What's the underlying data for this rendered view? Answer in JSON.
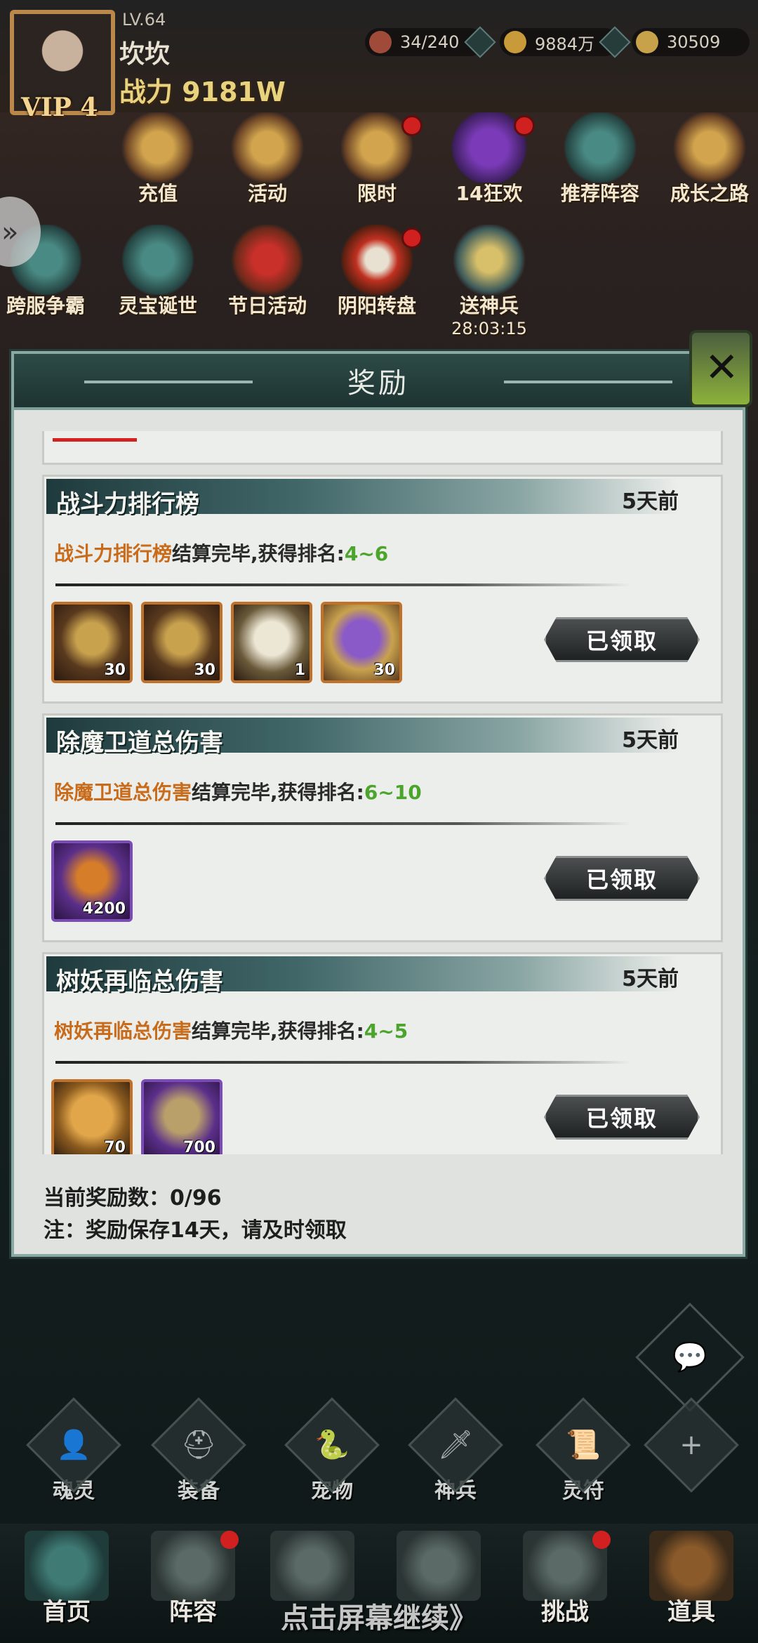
{
  "player": {
    "level": "LV.64",
    "name": "坎坎",
    "power": "战力 9181W",
    "vip": "VIP 4"
  },
  "resources": [
    {
      "icon": "stamina-icon",
      "value": "34/240"
    },
    {
      "icon": "coin-icon",
      "value": "9884万"
    },
    {
      "icon": "ingot-icon",
      "value": "30509"
    }
  ],
  "activities": [
    {
      "label": "充值",
      "icon": "recharge-icon",
      "dot": false
    },
    {
      "label": "活动",
      "icon": "activity-icon",
      "dot": false
    },
    {
      "label": "限时",
      "icon": "limited-icon",
      "dot": true
    },
    {
      "label": "14狂欢",
      "icon": "gift-box-icon",
      "dot": true
    },
    {
      "label": "推荐阵容",
      "icon": "lineup-icon",
      "dot": false
    },
    {
      "label": "成长之路",
      "icon": "growth-icon",
      "dot": false
    },
    {
      "label": "跨服争霸",
      "icon": "cross-server-icon",
      "dot": false
    },
    {
      "label": "灵宝诞世",
      "icon": "treasure-icon",
      "dot": false
    },
    {
      "label": "节日活动",
      "icon": "festival-icon",
      "dot": false
    },
    {
      "label": "阴阳转盘",
      "icon": "wheel-icon",
      "dot": true
    },
    {
      "label": "送神兵",
      "icon": "weapon-gift-icon",
      "dot": false,
      "timer": "28:03:15"
    }
  ],
  "modal": {
    "title": "奖励",
    "claim_label": "已领取",
    "cards": [
      {
        "title": "战斗力排行榜",
        "time": "5天前",
        "desc_name": "战斗力排行榜",
        "desc_mid": "结算完毕,获得排名:",
        "rank": "4~6",
        "items": [
          {
            "icon": "treasure-chest-icon",
            "count": "30",
            "style": "orange"
          },
          {
            "icon": "key-icon",
            "count": "30",
            "style": "orange"
          },
          {
            "icon": "scroll-icon",
            "count": "1",
            "style": "orange"
          },
          {
            "icon": "purple-chest-icon",
            "count": "30",
            "style": "orange"
          }
        ]
      },
      {
        "title": "除魔卫道总伤害",
        "time": "5天前",
        "desc_name": "除魔卫道总伤害",
        "desc_mid": "结算完毕,获得排名:",
        "rank": "6~10",
        "items": [
          {
            "icon": "flame-icon",
            "count": "4200",
            "style": "purple"
          }
        ]
      },
      {
        "title": "树妖再临总伤害",
        "time": "5天前",
        "desc_name": "树妖再临总伤害",
        "desc_mid": "结算完毕,获得排名:",
        "rank": "4~5",
        "items": [
          {
            "icon": "gold-orb-icon",
            "count": "70",
            "style": "orange"
          },
          {
            "icon": "bundle-icon",
            "count": "700",
            "style": "purple"
          }
        ]
      }
    ],
    "reward_count": "当前奖励数：0/96",
    "note": "注：奖励保存14天，请及时领取"
  },
  "tools": [
    {
      "label": "魂灵",
      "icon": "soul-icon",
      "glyph": "👤"
    },
    {
      "label": "装备",
      "icon": "equipment-icon",
      "glyph": "⛑"
    },
    {
      "label": "宠物",
      "icon": "pet-icon",
      "glyph": "🐍"
    },
    {
      "label": "神兵",
      "icon": "divine-weapon-icon",
      "glyph": "🗡"
    },
    {
      "label": "灵符",
      "icon": "talisman-icon",
      "glyph": "📜"
    },
    {
      "label": "",
      "icon": "plus-icon",
      "glyph": "+"
    }
  ],
  "nav": [
    {
      "label": "首页",
      "icon": "home-icon",
      "dot": false
    },
    {
      "label": "阵容",
      "icon": "formation-icon",
      "dot": true
    },
    {
      "label": "",
      "icon": "adventure-icon",
      "dot": false
    },
    {
      "label": "",
      "icon": "battle-icon",
      "dot": false
    },
    {
      "label": "挑战",
      "icon": "challenge-icon",
      "dot": true
    },
    {
      "label": "道具",
      "icon": "bag-icon",
      "dot": false
    }
  ],
  "continue_hint": "点击屏幕继续》",
  "colors": {
    "modal_header": "#2d4b48",
    "highlight": "#c86c1c",
    "rank": "#4ba42c",
    "badge": "#d0201f"
  }
}
